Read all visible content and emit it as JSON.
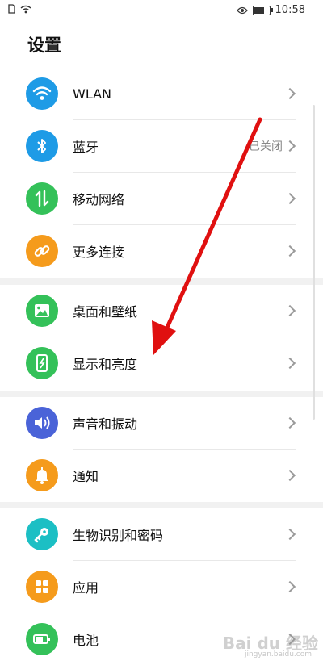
{
  "status_bar": {
    "time": "10:58"
  },
  "page": {
    "title": "设置"
  },
  "items": [
    {
      "label": "WLAN",
      "status": "",
      "icon": "wifi-icon",
      "color": "#1e9be6"
    },
    {
      "label": "蓝牙",
      "status": "已关闭",
      "icon": "bluetooth-icon",
      "color": "#1e9be6"
    },
    {
      "label": "移动网络",
      "status": "",
      "icon": "mobile-data-icon",
      "color": "#34c159"
    },
    {
      "label": "更多连接",
      "status": "",
      "icon": "link-icon",
      "color": "#f59b1c"
    },
    {
      "label": "桌面和壁纸",
      "status": "",
      "icon": "wallpaper-icon",
      "color": "#34c159"
    },
    {
      "label": "显示和亮度",
      "status": "",
      "icon": "display-icon",
      "color": "#34c159"
    },
    {
      "label": "声音和振动",
      "status": "",
      "icon": "sound-icon",
      "color": "#4a63d8"
    },
    {
      "label": "通知",
      "status": "",
      "icon": "bell-icon",
      "color": "#f59b1c"
    },
    {
      "label": "生物识别和密码",
      "status": "",
      "icon": "key-icon",
      "color": "#1cbfc4"
    },
    {
      "label": "应用",
      "status": "",
      "icon": "apps-icon",
      "color": "#f59b1c"
    },
    {
      "label": "电池",
      "status": "",
      "icon": "battery-icon",
      "color": "#34c159"
    }
  ],
  "watermark": {
    "text": "Bai du 经验",
    "sub": "jingyan.baidu.com"
  }
}
